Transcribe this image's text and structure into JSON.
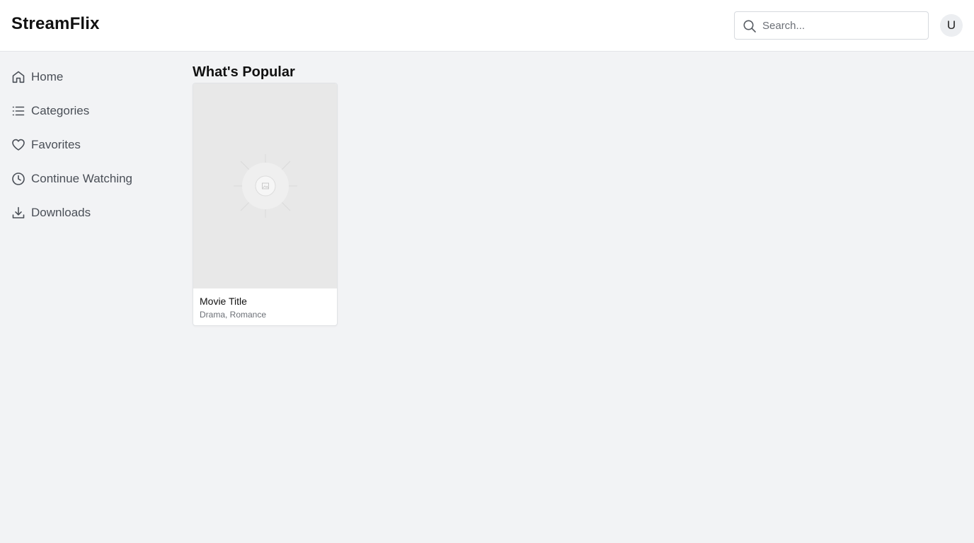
{
  "app": {
    "brand": "StreamFlix"
  },
  "search": {
    "placeholder": "Search...",
    "icon": "search-icon"
  },
  "user": {
    "avatar_initial": "U"
  },
  "sidebar": {
    "items": [
      {
        "label": "Home",
        "icon": "home-icon"
      },
      {
        "label": "Categories",
        "icon": "list-icon"
      },
      {
        "label": "Favorites",
        "icon": "heart-icon"
      },
      {
        "label": "Continue Watching",
        "icon": "clock-icon"
      },
      {
        "label": "Downloads",
        "icon": "download-icon"
      }
    ]
  },
  "main": {
    "section_title": "What's Popular",
    "movies": [
      {
        "title": "Movie Title",
        "genres": "Drama, Romance",
        "poster_icon": "image-placeholder-icon"
      }
    ]
  },
  "colors": {
    "background": "#f2f3f5",
    "header": "#ffffff",
    "text": "#111111",
    "muted": "#6b6f76",
    "nav_text": "#4a4f57",
    "poster_placeholder": "#e8e8e8"
  }
}
